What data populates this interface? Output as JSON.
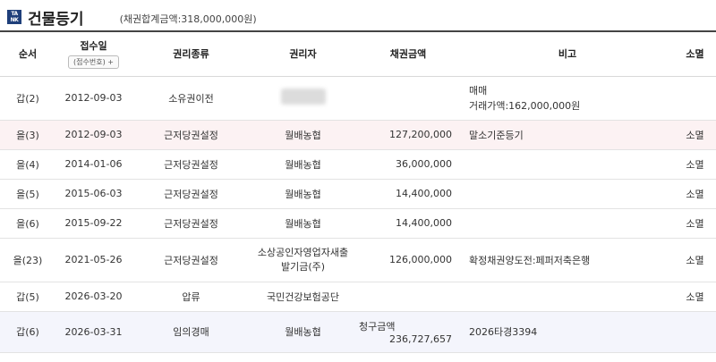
{
  "header": {
    "logo_line1": "TA",
    "logo_line2": "NK",
    "title": "건물등기",
    "bond_total": "(채권합계금액:318,000,000원)"
  },
  "columns": {
    "seq": "순서",
    "receipt": "접수일",
    "receipt_sub_btn": "(접수번호) +",
    "right_type": "권리종류",
    "holder": "권리자",
    "bond": "채권금액",
    "note": "비고",
    "extinct": "소멸"
  },
  "rows": [
    {
      "seq": "갑(2)",
      "date": "2012-09-03",
      "type": "소유권이전",
      "holder": "",
      "holder_blurred": true,
      "bond": "",
      "note": "매매",
      "note2": "거래가액:162,000,000원",
      "extinct": ""
    },
    {
      "seq": "을(3)",
      "date": "2012-09-03",
      "type": "근저당권설정",
      "holder": "월배농협",
      "bond": "127,200,000",
      "note": "말소기준등기",
      "extinct": "소멸",
      "highlight": "pink"
    },
    {
      "seq": "을(4)",
      "date": "2014-01-06",
      "type": "근저당권설정",
      "holder": "월배농협",
      "bond": "36,000,000",
      "note": "",
      "extinct": "소멸"
    },
    {
      "seq": "을(5)",
      "date": "2015-06-03",
      "type": "근저당권설정",
      "holder": "월배농협",
      "bond": "14,400,000",
      "note": "",
      "extinct": "소멸"
    },
    {
      "seq": "을(6)",
      "date": "2015-09-22",
      "type": "근저당권설정",
      "holder": "월배농협",
      "bond": "14,400,000",
      "note": "",
      "extinct": "소멸"
    },
    {
      "seq": "을(23)",
      "date": "2021-05-26",
      "type": "근저당권설정",
      "holder": "소상공인자영업자새출",
      "holder2": "발기금(주)",
      "bond": "126,000,000",
      "note": "확정채권양도전:페퍼저축은행",
      "extinct": "소멸"
    },
    {
      "seq": "갑(5)",
      "date": "2026-03-20",
      "type": "압류",
      "holder": "국민건강보험공단",
      "bond": "",
      "note": "",
      "extinct": "소멸"
    },
    {
      "seq": "갑(6)",
      "date": "2026-03-31",
      "type": "임의경매",
      "holder": "월배농협",
      "bond_label": "청구금액",
      "bond": "236,727,657",
      "note": "2026타경3394",
      "extinct": "",
      "highlight": "blue"
    }
  ]
}
